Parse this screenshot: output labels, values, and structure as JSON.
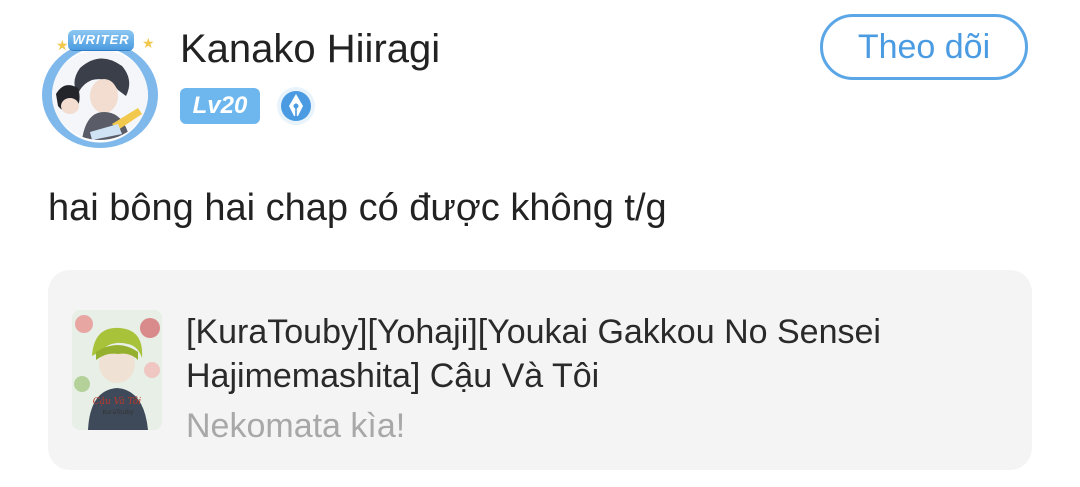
{
  "user": {
    "name": "Kanako Hiiragi",
    "avatar_badge": "WRITER",
    "level": "Lv20",
    "role_icon": "pen-nib-icon"
  },
  "follow_button": {
    "label": "Theo dõi"
  },
  "comment": {
    "text": "hai bông hai chap có được không t/g"
  },
  "quoted_story": {
    "title": "[KuraTouby][Yohaji][Youkai Gakkou No Sensei Hajimemashita] Cậu Và Tôi",
    "subtitle": "Nekomata kìa!",
    "cover_icon": "story-cover-image"
  },
  "colors": {
    "accent": "#5aa6e6",
    "level_badge": "#6eb6ee",
    "card_background": "#f4f4f5",
    "muted_text": "#a8a8a8"
  }
}
